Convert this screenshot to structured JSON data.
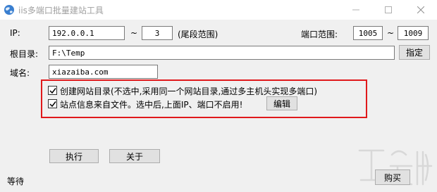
{
  "window": {
    "title": "iis多端口批量建站工具"
  },
  "ip_row": {
    "label": "IP:",
    "ip_value": "192.0.0.1",
    "tilde1": "~",
    "end_value": "3",
    "hint": "(尾段范围)",
    "port_label": "端口范围:",
    "port_start": "1005",
    "tilde2": "~",
    "port_end": "1009"
  },
  "root_row": {
    "label": "根目录:",
    "value": "F:\\Temp",
    "button": "指定"
  },
  "domain_row": {
    "label": "域名:",
    "value": "xiazaiba.com"
  },
  "options": {
    "create_dir": {
      "label": "创建网站目录(不选中,采用同一个网站目录,通过多主机头实现多端口)",
      "checked": true
    },
    "from_file": {
      "label": "站点信息来自文件。选中后,上面IP、端口不启用!",
      "checked": true,
      "edit_button": "编辑"
    }
  },
  "actions": {
    "run": "执行",
    "about": "关于",
    "buy": "购买"
  },
  "status": {
    "text": "等待"
  },
  "colors": {
    "highlight_border": "#e0191b",
    "window_bg": "#f0f0f0",
    "title_text": "#a0a0a0"
  },
  "icons": {
    "app": "globe-icon",
    "check": "check-icon"
  }
}
